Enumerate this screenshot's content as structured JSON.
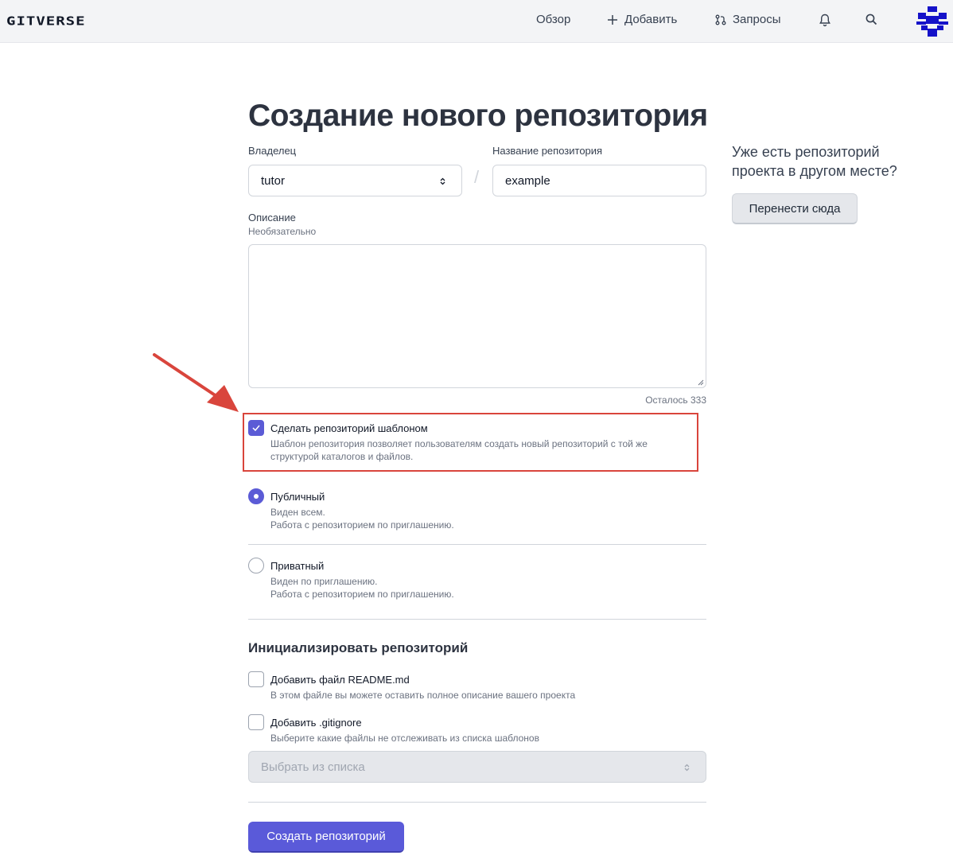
{
  "header": {
    "logo": "GITVERSE",
    "nav": {
      "overview": "Обзор",
      "add": "Добавить",
      "requests": "Запросы"
    },
    "icons": [
      "plus-icon",
      "pull-request-icon",
      "bell-icon",
      "search-icon",
      "avatar"
    ]
  },
  "page": {
    "title": "Создание нового репозитория",
    "owner_label": "Владелец",
    "owner_value": "tutor",
    "repo_name_label": "Название репозитория",
    "repo_name_value": "example",
    "separator": "/",
    "description_label": "Описание",
    "description_optional": "Необязательно",
    "description_value": "",
    "chars_left": "Осталось 333",
    "template": {
      "label": "Сделать репозиторий шаблоном",
      "desc_line1": "Шаблон репозитория позволяет пользователям создать новый репозиторий с той же",
      "desc_line2": "структурой каталогов и файлов.",
      "checked": true
    },
    "visibility": {
      "public_label": "Публичный",
      "public_desc1": "Виден всем.",
      "public_desc2": "Работа с репозиторием по приглашению.",
      "private_label": "Приватный",
      "private_desc1": "Виден по приглашению.",
      "private_desc2": "Работа с репозиторием по приглашению.",
      "selected": "public"
    },
    "init": {
      "title": "Инициализировать репозиторий",
      "readme_label": "Добавить файл README.md",
      "readme_desc": "В этом файле вы можете оставить полное описание вашего проекта",
      "gitignore_label": "Добавить .gitignore",
      "gitignore_desc": "Выберите какие файлы не отслеживать из списка шаблонов",
      "gitignore_select_placeholder": "Выбрать из списка"
    },
    "submit_label": "Создать репозиторий"
  },
  "sidebar": {
    "question_line1": "Уже есть репозиторий",
    "question_line2": "проекта в другом месте?",
    "migrate_label": "Перенести сюда"
  },
  "colors": {
    "accent": "#5a5ad9",
    "highlight_annotation": "#d9453c"
  }
}
